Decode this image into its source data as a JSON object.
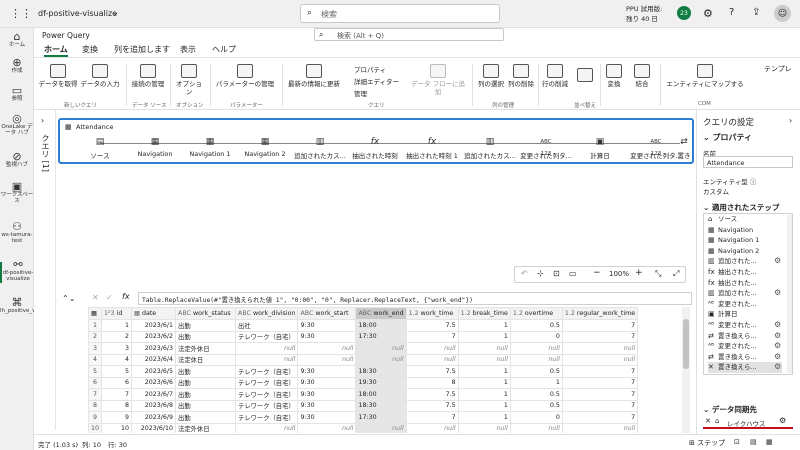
{
  "app": {
    "name": "df-positive-visualize",
    "search_placeholder": "検索",
    "trial": "PPU 試用版:",
    "trial_days": "残り 40 日",
    "notif": "23"
  },
  "nav": [
    {
      "label": "ホーム",
      "icon": "home-icon",
      "glyph": "⌂"
    },
    {
      "label": "作成",
      "icon": "create-icon",
      "glyph": "⊕"
    },
    {
      "label": "参照",
      "icon": "browse-icon",
      "glyph": "▭"
    },
    {
      "label": "OneLake データ ハブ",
      "icon": "onelake-icon",
      "glyph": "◎"
    },
    {
      "label": "監視ハブ",
      "icon": "monitor-icon",
      "glyph": "⊘"
    },
    {
      "label": "ワークスペース",
      "icon": "workspace-icon",
      "glyph": "▣"
    },
    {
      "label": "ws-tamura-test",
      "icon": "ws-icon",
      "glyph": "⚇"
    },
    {
      "label": "df-positive-visualize",
      "icon": "dataflow-icon",
      "glyph": "⚯"
    },
    {
      "label": "lh_positive_visualize",
      "icon": "lakehouse-icon",
      "glyph": "⌘"
    }
  ],
  "pq": {
    "title": "Power Query",
    "search_placeholder": "検索 (Alt + Q)"
  },
  "tabs": [
    "ホーム",
    "変換",
    "列を追加します",
    "表示",
    "ヘルプ"
  ],
  "ribbon": {
    "get_data": "データを取得",
    "enter_data": "データの入力",
    "new_query": "新しいクエリ",
    "manage_conn": "接続の管理",
    "data_source": "データ ソース",
    "options": "オプション",
    "options_grp": "オプション",
    "manage_params": "パラメーターの管理",
    "params_grp": "パラメーター",
    "refresh": "最新の情報に更新",
    "properties": "プロパティ",
    "adv_editor": "詳細エディター",
    "manage": "管理",
    "query_grp": "クエリ",
    "add_to_flow": "データ フローに追加",
    "choose_cols": "列の選択",
    "remove_cols": "列の削除",
    "manage_cols": "列の管理",
    "reduce_rows": "行の削減",
    "sort_grp": "並べ替え",
    "transform": "変換",
    "combine": "結合",
    "map_entity": "エンティティにマップする",
    "cdm": "CDM",
    "template": "テンプレ"
  },
  "side_label": "クエリ [1]",
  "diagram": {
    "title": "Attendance",
    "steps": [
      "ソース",
      "Navigation",
      "Navigation 1",
      "Navigation 2",
      "追加されたカス...",
      "抽出された時刻",
      "抽出された時刻 1",
      "追加されたカス...",
      "変更された列タ...",
      "計算日",
      "変更された列タ...",
      "置き"
    ]
  },
  "zoom": "100%",
  "formula": "Table.ReplaceValue(#\"置き換えられた値 1\", \"0:00\", \"0\", Replacer.ReplaceText, {\"work_end\"})",
  "table": {
    "headers": [
      "id",
      "date",
      "work_status",
      "work_division",
      "work_start",
      "work_end",
      "work_time",
      "break_time",
      "overtime",
      "regular_work_time"
    ],
    "types": [
      "1²3",
      "▦",
      "ABC",
      "ABC",
      "ABC",
      "ABC",
      "1.2",
      "1.2",
      "1.2",
      "1.2"
    ],
    "rows": [
      [
        "1",
        "2023/6/1",
        "出勤",
        "出社",
        "9:30",
        "18:00",
        "7.5",
        "1",
        "0.5",
        "7"
      ],
      [
        "2",
        "2023/6/2",
        "出勤",
        "テレワーク（自宅）",
        "9:30",
        "17:30",
        "7",
        "1",
        "0",
        "7"
      ],
      [
        "3",
        "2023/6/3",
        "法定外休日",
        "null",
        "null",
        "null",
        "null",
        "null",
        "null",
        "null"
      ],
      [
        "4",
        "2023/6/4",
        "法定休日",
        "null",
        "null",
        "null",
        "null",
        "null",
        "null",
        "null"
      ],
      [
        "5",
        "2023/6/5",
        "出勤",
        "テレワーク（自宅）",
        "9:30",
        "18:30",
        "7.5",
        "1",
        "0.5",
        "7"
      ],
      [
        "6",
        "2023/6/6",
        "出勤",
        "テレワーク（自宅）",
        "9:30",
        "19:30",
        "8",
        "1",
        "1",
        "7"
      ],
      [
        "7",
        "2023/6/7",
        "出勤",
        "テレワーク（自宅）",
        "9:30",
        "18:00",
        "7.5",
        "1",
        "0.5",
        "7"
      ],
      [
        "8",
        "2023/6/8",
        "出勤",
        "テレワーク（自宅）",
        "9:30",
        "18:30",
        "7.5",
        "1",
        "0.5",
        "7"
      ],
      [
        "9",
        "2023/6/9",
        "出勤",
        "テレワーク（自宅）",
        "9:30",
        "17:30",
        "7",
        "1",
        "0",
        "7"
      ],
      [
        "10",
        "2023/6/10",
        "法定外休日",
        "null",
        "null",
        "null",
        "null",
        "null",
        "null",
        "null"
      ]
    ]
  },
  "status": {
    "done": "完了 (1.03 s)",
    "cols": "列: 10",
    "rows": "行: 30",
    "step_label": "ステップ"
  },
  "settings": {
    "title": "クエリの設定",
    "props": "プロパティ",
    "name_label": "名前",
    "name_value": "Attendance",
    "entity_label": "エンティティ型",
    "entity_value": "カスタム",
    "applied": "適用されたステップ",
    "steps": [
      "ソース",
      "Navigation",
      "Navigation 1",
      "Navigation 2",
      "追加された...",
      "抽出された...",
      "抽出された...",
      "追加された...",
      "変更された...",
      "計算日",
      "変更された...",
      "置き換えら...",
      "変更された...",
      "置き換えら...",
      "置き換えら..."
    ],
    "dest": "データ同期先",
    "dest_value": "レイクハウス"
  }
}
